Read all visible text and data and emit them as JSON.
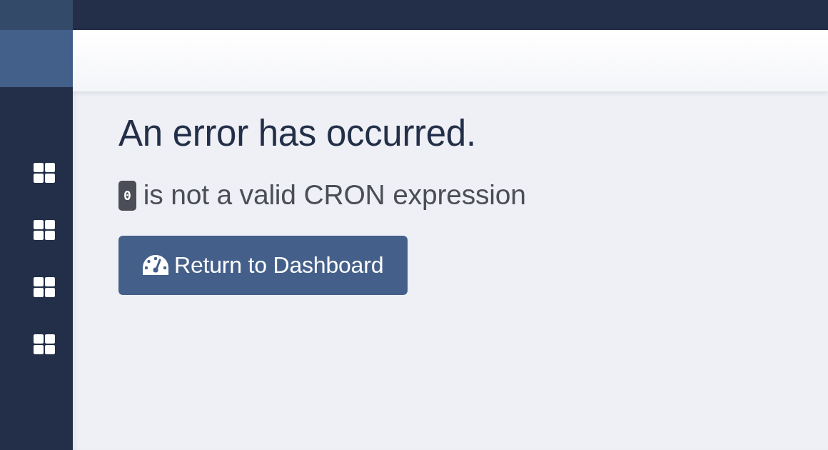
{
  "error": {
    "title": "An error has occurred.",
    "code": "0",
    "message": "is not a valid CRON expression",
    "button": "Return to Dashboard"
  }
}
